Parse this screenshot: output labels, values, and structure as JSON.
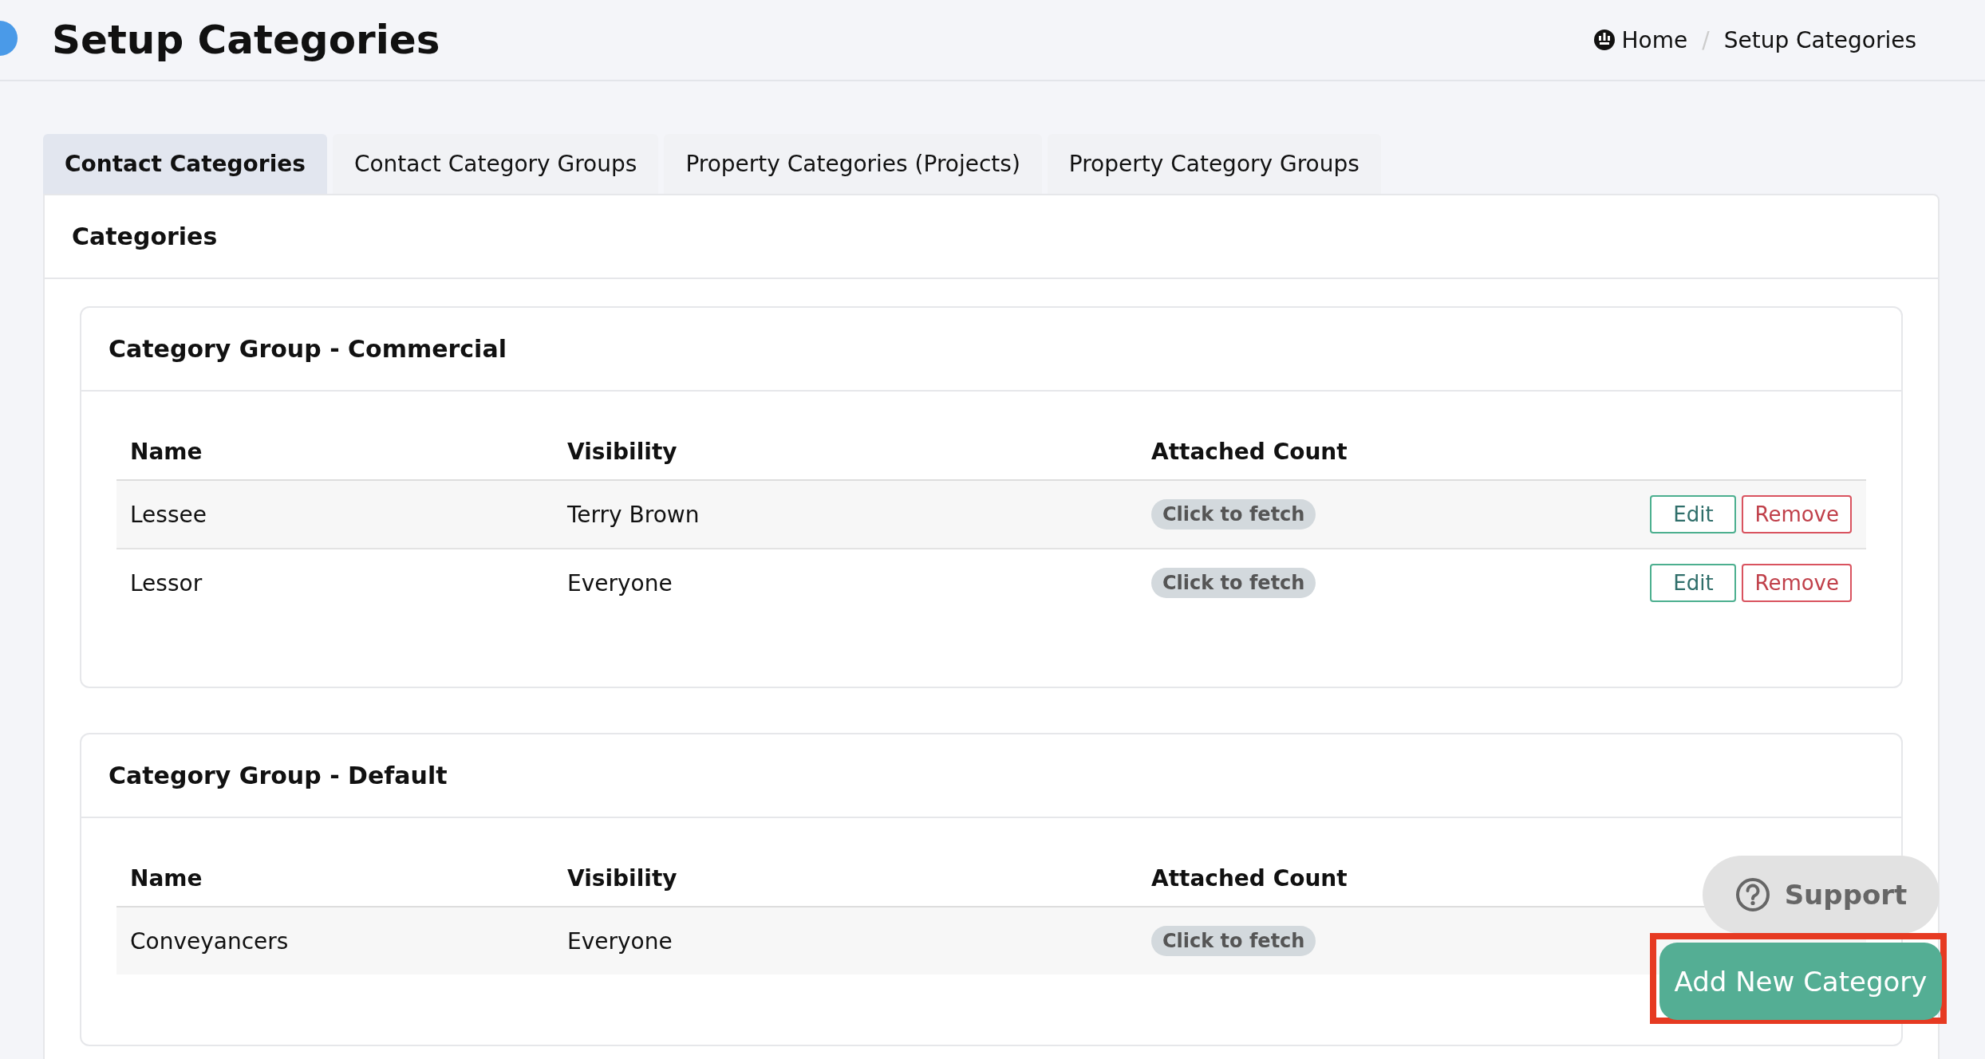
{
  "header": {
    "title": "Setup Categories",
    "breadcrumb": [
      {
        "label": "Home",
        "icon": true
      },
      {
        "label": "Setup Categories",
        "icon": false,
        "separator": "/"
      }
    ]
  },
  "tabs": [
    {
      "label": "Contact Categories",
      "selected": true
    },
    {
      "label": "Contact Category Groups",
      "selected": false
    },
    {
      "label": "Property Categories (Projects)",
      "selected": false
    },
    {
      "label": "Property Category Groups",
      "selected": false
    }
  ],
  "panel": {
    "title": "Categories",
    "groups": [
      {
        "title": "Category Group - Commercial",
        "columns": [
          "Name",
          "Visibility",
          "Attached Count"
        ],
        "rows": [
          {
            "name": "Lessee",
            "visibility": "Terry Brown",
            "count": "Click to fetch",
            "actions": [
              "Edit",
              "Remove"
            ]
          },
          {
            "name": "Lessor",
            "visibility": "Everyone",
            "count": "Click to fetch",
            "actions": [
              "Edit",
              "Remove"
            ]
          }
        ]
      },
      {
        "title": "Category Group - Default",
        "columns": [
          "Name",
          "Visibility",
          "Attached Count"
        ],
        "rows": [
          {
            "name": "Conveyancers",
            "visibility": "Everyone",
            "count": "Click to fetch",
            "actions": []
          }
        ]
      }
    ]
  },
  "support_button": {
    "label": "Support"
  },
  "add_button": {
    "label": "Add New Category",
    "highlighted": true
  }
}
